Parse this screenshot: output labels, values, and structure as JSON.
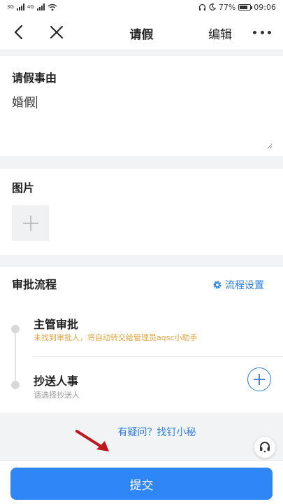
{
  "status_bar": {
    "network_1": "3G",
    "network_2": "4G",
    "battery": "77%",
    "battery_level": 0.77,
    "time": "09:06"
  },
  "nav": {
    "title": "请假",
    "edit": "编辑"
  },
  "reason": {
    "label": "请假事由",
    "value": "婚假"
  },
  "images": {
    "label": "图片"
  },
  "approval": {
    "label": "审批流程",
    "settings": "流程设置",
    "steps": [
      {
        "title": "主管审批",
        "subtitle": "未找到审批人，将自动转交给管理员aqsc小助手"
      },
      {
        "title": "抄送人事",
        "subtitle": "请选择抄送人"
      }
    ]
  },
  "help": {
    "text": "有疑问？找钉小秘"
  },
  "submit": {
    "label": "提交"
  },
  "colors": {
    "accent": "#2b7de9",
    "button": "#2f86f6",
    "warning_text": "#e6a23c",
    "arrow": "#c0171c"
  }
}
